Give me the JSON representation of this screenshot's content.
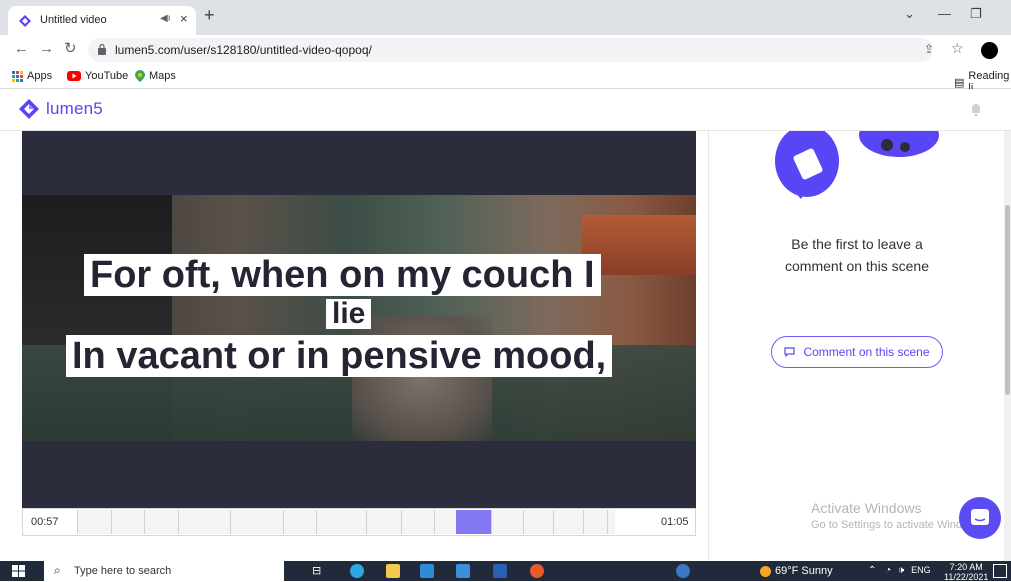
{
  "browser": {
    "tab_title": "Untitled video",
    "tab_audio_icon": "speaker-icon",
    "tab_close": "×",
    "new_tab": "+",
    "url": "lumen5.com/user/s128180/untitled-video-qopoq/",
    "bookmarks": [
      {
        "label": "Apps",
        "icon": "apps-grid-icon",
        "color": "#e8453c"
      },
      {
        "label": "YouTube",
        "icon": "youtube-icon",
        "color": "#ff0000"
      },
      {
        "label": "Maps",
        "icon": "maps-pin-icon",
        "color": "#34a853"
      }
    ],
    "reading_list": "Reading li"
  },
  "app": {
    "logo_text": "lumen5",
    "accent": "#5846f6"
  },
  "video": {
    "caption_line1": "For oft, when on my couch I",
    "caption_line2": "lie",
    "caption_line3": "In vacant or in pensive mood,",
    "time_start": "00:57",
    "time_end": "01:05"
  },
  "comments": {
    "empty_message_line1": "Be the first to leave a",
    "empty_message_line2": "comment on this scene",
    "button_label": "Comment on this scene"
  },
  "watermark": {
    "line1": "Activate Windows",
    "line2": "Go to Settings to activate Wind"
  },
  "taskbar": {
    "search_placeholder": "Type here to search",
    "weather": "69°F Sunny",
    "language": "ENG",
    "time": "7:20 AM",
    "date": "11/22/2021"
  }
}
